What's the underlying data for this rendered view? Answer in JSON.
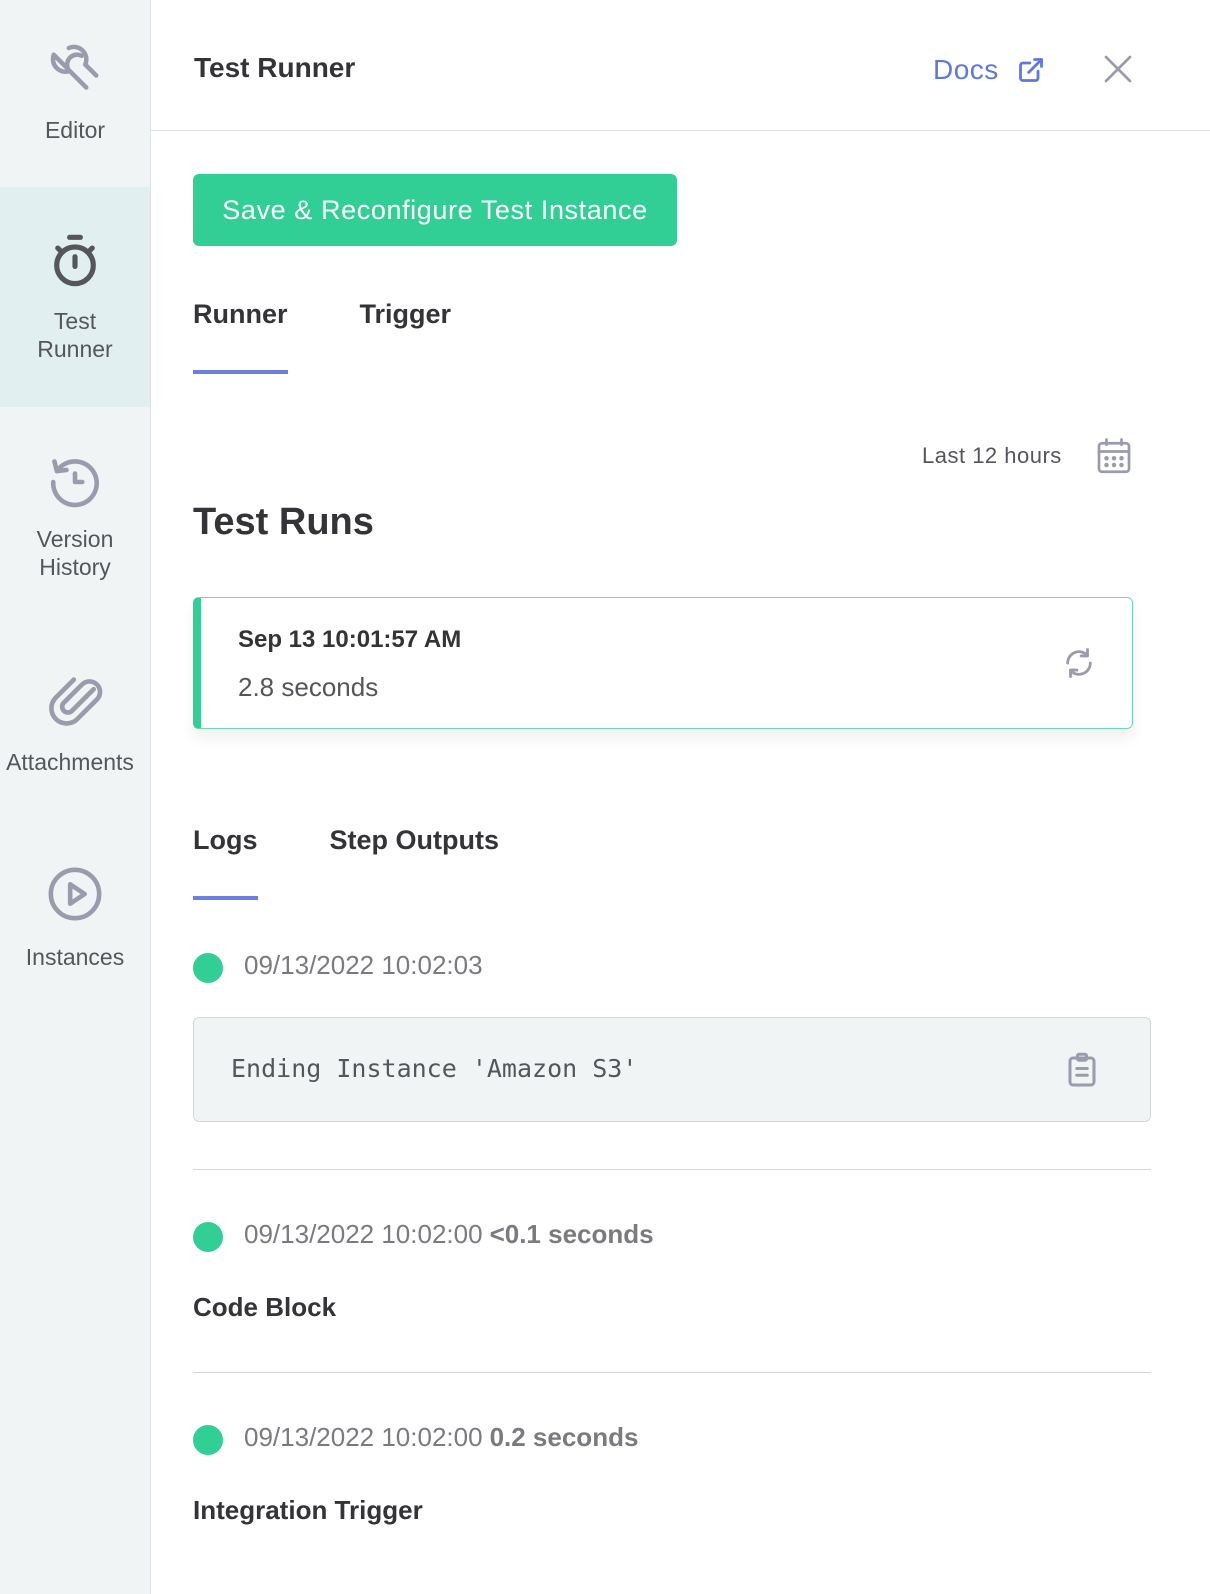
{
  "sidebar": {
    "items": [
      {
        "label_line1": "Editor",
        "label_line2": "",
        "icon": "wrench-icon",
        "active": false
      },
      {
        "label_line1": "Test",
        "label_line2": "Runner",
        "icon": "stopwatch-icon",
        "active": true
      },
      {
        "label_line1": "Version",
        "label_line2": "History",
        "icon": "history-icon",
        "active": false
      },
      {
        "label_line1": "Attachments",
        "label_line2": "",
        "icon": "paperclip-icon",
        "active": false
      },
      {
        "label_line1": "Instances",
        "label_line2": "",
        "icon": "play-circle-icon",
        "active": false
      }
    ]
  },
  "header": {
    "title": "Test Runner",
    "docs_label": "Docs",
    "docs_icon": "external-link-icon",
    "close_icon": "close-icon"
  },
  "main": {
    "primary_button": "Save & Reconfigure Test Instance",
    "tabs": [
      {
        "label": "Runner",
        "active": true
      },
      {
        "label": "Trigger",
        "active": false
      }
    ],
    "filter": {
      "label": "Last 12 hours",
      "icon": "calendar-icon"
    },
    "section_title": "Test Runs",
    "run_card": {
      "date": "Sep 13 10:01:57 AM",
      "duration": "2.8 seconds",
      "icon": "refresh-icon"
    },
    "sub_tabs": [
      {
        "label": "Logs",
        "active": true
      },
      {
        "label": "Step Outputs",
        "active": false
      }
    ],
    "logs": [
      {
        "timestamp": "09/13/2022 10:02:03",
        "duration": "",
        "message": "Ending Instance 'Amazon S3'",
        "status": "success"
      },
      {
        "timestamp": "09/13/2022 10:02:00",
        "duration": "<0.1 seconds",
        "step": "Code Block",
        "status": "success"
      },
      {
        "timestamp": "09/13/2022 10:02:00",
        "duration": "0.2 seconds",
        "step": "Integration Trigger",
        "status": "success"
      }
    ]
  },
  "colors": {
    "accent_green": "#31cf95",
    "accent_blue": "#6a7fdf",
    "link_blue": "#5d79e0",
    "sidebar_bg": "#f1f4f5",
    "sidebar_active_bg": "#e1eff1"
  }
}
